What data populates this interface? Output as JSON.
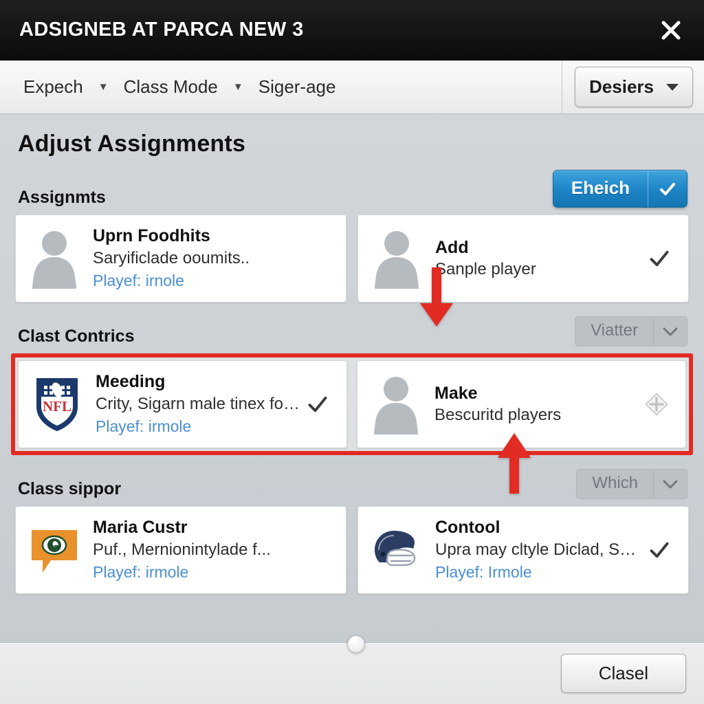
{
  "window": {
    "title": "ADSIGNEB AT PARCA NEW 3",
    "close_icon": "close-icon"
  },
  "toolbar": {
    "items": [
      {
        "label": "Expech",
        "icon": "chevron-down-icon"
      },
      {
        "label": "Class Mode",
        "icon": "chevron-down-icon"
      },
      {
        "label": "Siger-age",
        "icon": ""
      }
    ],
    "right_button": {
      "label": "Desiers",
      "icon": "caret-down-icon"
    }
  },
  "main": {
    "page_title": "Adjust Assignments",
    "sections": [
      {
        "title": "Assignmts",
        "action": {
          "type": "primary",
          "label": "Eheich",
          "icon": "check-icon"
        },
        "cards": [
          {
            "avatar": "person-silhouette-icon",
            "title": "Uprn Foodhits",
            "subtitle": "Saryificlade ooumits..",
            "link": "Playef: irnole",
            "right_icon": ""
          },
          {
            "avatar": "person-silhouette-icon",
            "title": "Add",
            "subtitle": "Sanple player",
            "link": "",
            "right_icon": "check-icon"
          }
        ]
      },
      {
        "title": "Clast Contrics",
        "action": {
          "type": "dropdown",
          "label": "Viatter",
          "icon": "chevron-down-icon"
        },
        "highlighted": true,
        "cards": [
          {
            "avatar": "nfl-shield-logo-icon",
            "title": "Meeding",
            "subtitle": "Crity, Sigarn male tinex foot..",
            "link": "Playef: irmole",
            "right_icon": "check-icon"
          },
          {
            "avatar": "person-silhouette-icon",
            "title": "Make",
            "subtitle": "Bescuritd players",
            "link": "",
            "right_icon": "move-diamond-icon"
          }
        ]
      },
      {
        "title": "Class sippor",
        "action": {
          "type": "dropdown",
          "label": "Which",
          "icon": "chevron-down-icon"
        },
        "cards": [
          {
            "avatar": "packers-g-bubble-logo-icon",
            "title": "Maria Custr",
            "subtitle": "Puf., Mernionintylade f...",
            "link": "Playef: irmole",
            "right_icon": ""
          },
          {
            "avatar": "football-helmet-icon",
            "title": "Contool",
            "subtitle": "Upra may cltyle Diclad, Skil..",
            "link": "Playef: Irmole",
            "right_icon": "check-icon"
          }
        ]
      }
    ]
  },
  "annotations": {
    "arrow_down": "red-arrow-down-icon",
    "arrow_up": "red-arrow-up-icon",
    "highlight_color": "#e22b22"
  },
  "footer": {
    "close_label": "Clasel",
    "resize_handle": "resize-grip-handle"
  },
  "colors": {
    "titlebar": "#141415",
    "accent_blue": "#1c84c6",
    "link_blue": "#4a8fd0",
    "annotation_red": "#e22b22",
    "body_bg": "#cbd0d5"
  }
}
